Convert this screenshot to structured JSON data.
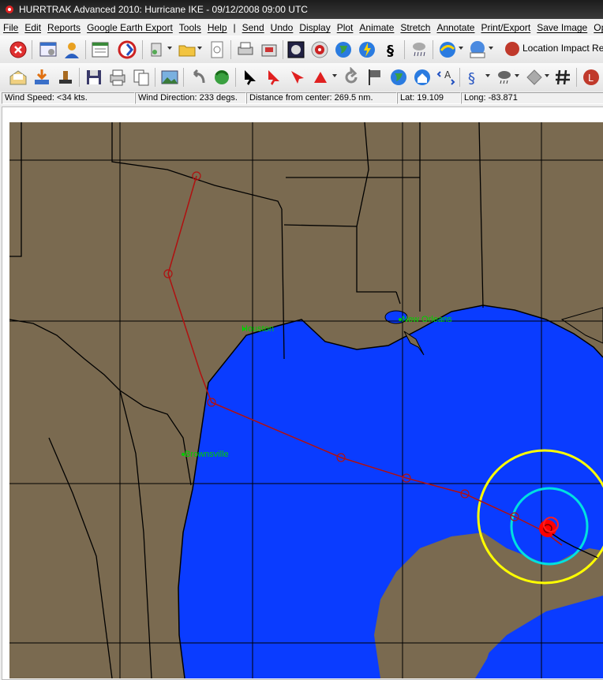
{
  "window": {
    "title": "HURRTRAK Advanced 2010: Hurricane IKE - 09/12/2008 09:00 UTC"
  },
  "menu": [
    "File",
    "Edit",
    "Reports",
    "Google Earth Export",
    "Tools",
    "Help",
    "|",
    "Send",
    "Undo",
    "Display",
    "Plot",
    "Animate",
    "Stretch",
    "Annotate",
    "Print/Export",
    "Save Image",
    "Op"
  ],
  "toolbar": {
    "location_impact_label": "Location Impact Repo"
  },
  "status": {
    "wind_speed": "Wind Speed: <34 kts.",
    "wind_direction": "Wind Direction: 233 degs.",
    "distance": "Distance from center: 269.5 nm.",
    "lat": "Lat: 19.109",
    "long": "Long: -83.871"
  },
  "map": {
    "cities": [
      {
        "name": "Houston"
      },
      {
        "name": "New Orleans"
      },
      {
        "name": "Brownsville"
      }
    ],
    "colors": {
      "land": "#7a6a50",
      "water": "#0a3cff",
      "track": "#b01010",
      "wind34": "#ffff00",
      "wind50": "#00e0e0",
      "wind64": "#ff0000",
      "city": "#00d000"
    }
  }
}
